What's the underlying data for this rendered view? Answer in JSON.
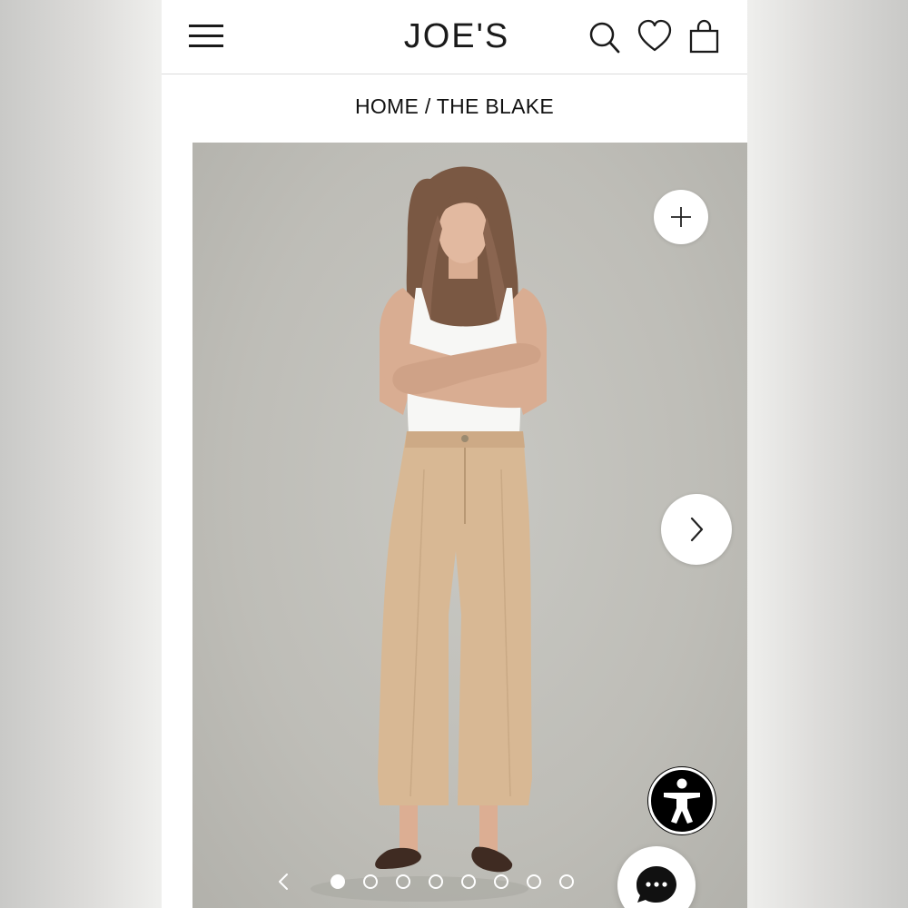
{
  "header": {
    "logo_text": "JOE'S",
    "icons": [
      "menu-icon",
      "search-icon",
      "heart-icon",
      "shopping-bag-icon"
    ]
  },
  "breadcrumb": {
    "home": "HOME",
    "separator": " / ",
    "current": "THE BLAKE"
  },
  "gallery": {
    "total_images": 8,
    "active_index": 0,
    "icons": [
      "plus-icon",
      "chevron-right-icon",
      "chevron-left-icon",
      "accessibility-icon",
      "chat-bubble-icon"
    ]
  },
  "colors": {
    "background": "#ffffff",
    "photo_backdrop": "#bebdb7",
    "pants": "#d8b894",
    "text": "#111111"
  }
}
